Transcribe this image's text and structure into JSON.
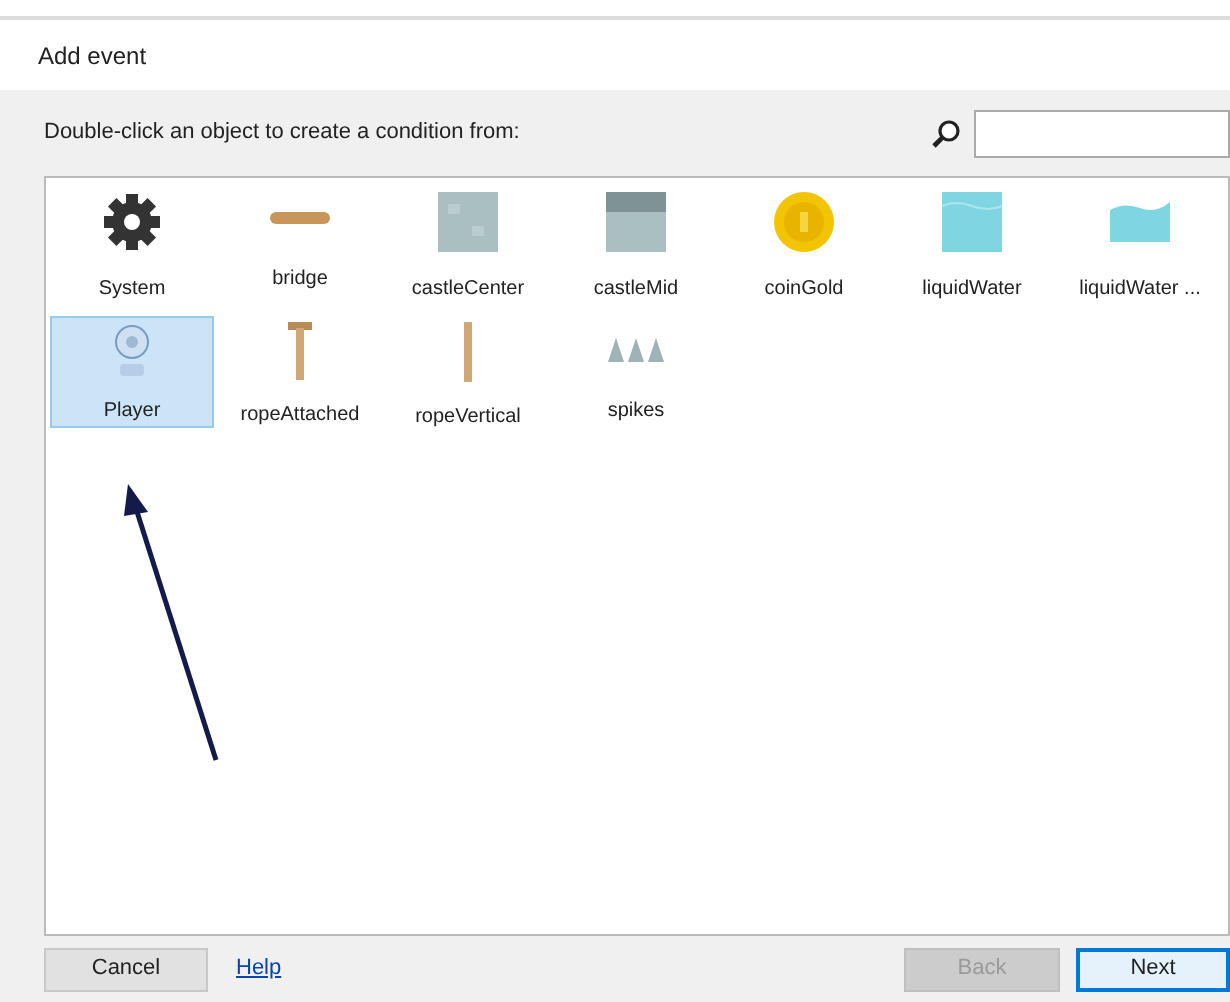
{
  "window": {
    "title": "Add event"
  },
  "instruction": "Double-click an object to create a condition from:",
  "objects": [
    {
      "label": "System",
      "kind": "gear",
      "selected": false
    },
    {
      "label": "bridge",
      "kind": "bar",
      "selected": false
    },
    {
      "label": "castleCenter",
      "kind": "tile",
      "selected": false
    },
    {
      "label": "castleMid",
      "kind": "tile-top",
      "selected": false
    },
    {
      "label": "coinGold",
      "kind": "coin",
      "selected": false
    },
    {
      "label": "liquidWater",
      "kind": "water",
      "selected": false
    },
    {
      "label": "liquidWater ...",
      "kind": "wave",
      "selected": false
    },
    {
      "label": "Player",
      "kind": "player",
      "selected": true
    },
    {
      "label": "ropeAttached",
      "kind": "rope-top",
      "selected": false
    },
    {
      "label": "ropeVertical",
      "kind": "rope",
      "selected": false
    },
    {
      "label": "spikes",
      "kind": "spikes",
      "selected": false
    }
  ],
  "footer": {
    "cancel": "Cancel",
    "help": "Help",
    "back": {
      "label": "Back",
      "disabled": true
    },
    "next": {
      "label": "Next",
      "disabled": false
    }
  }
}
